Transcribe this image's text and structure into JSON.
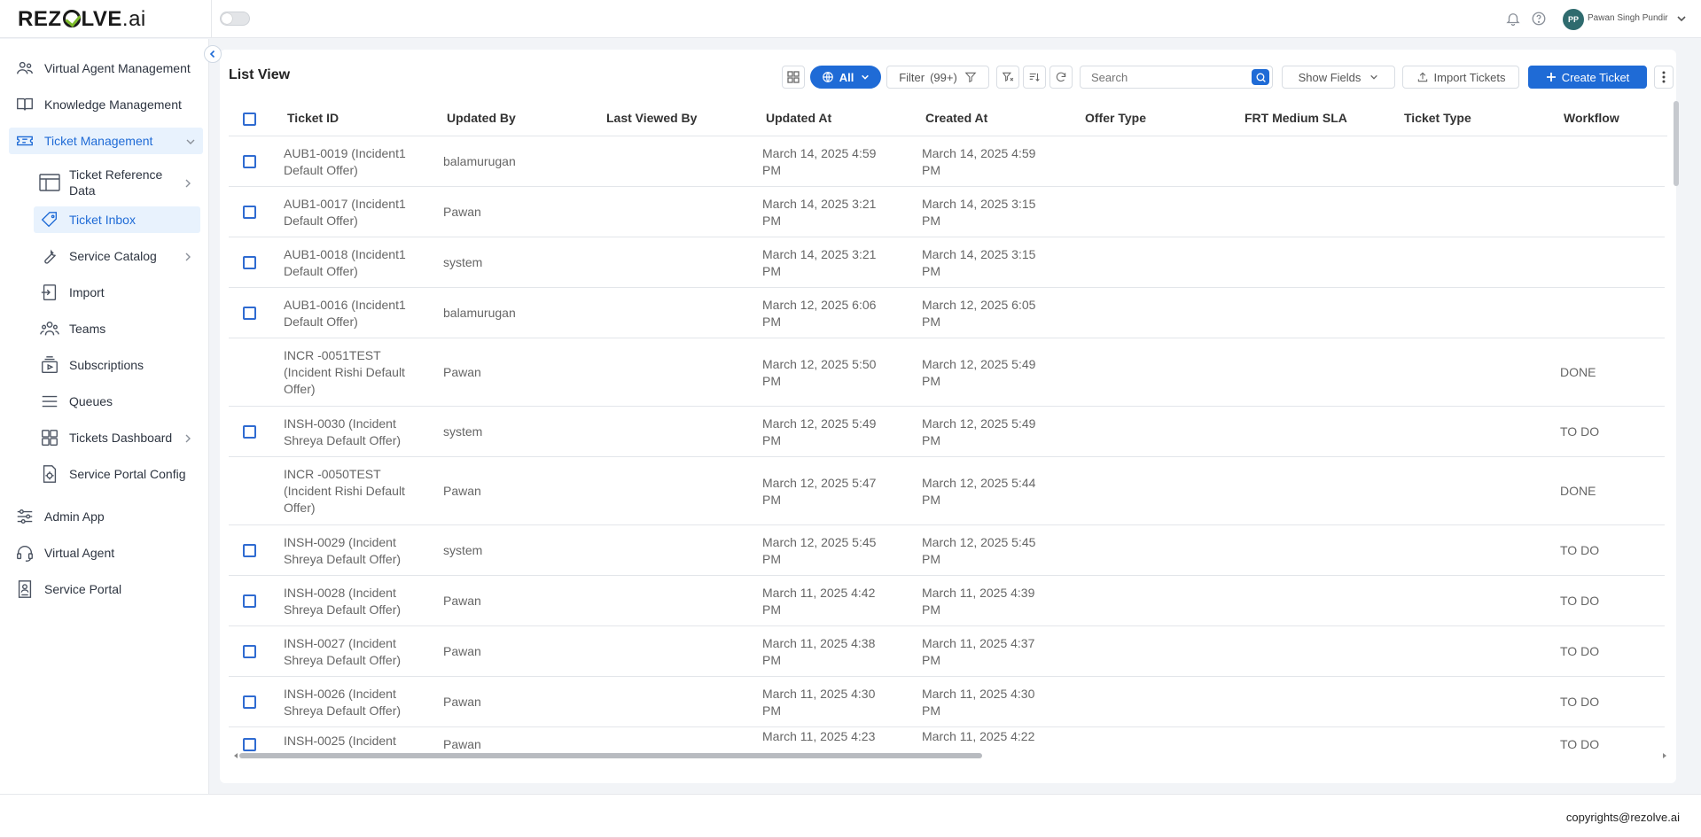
{
  "header": {
    "logo_main": "REZ",
    "logo_tail": "LVE",
    "logo_ai": ".ai",
    "user_initials": "PP",
    "user_name": "Pawan Singh Pundir"
  },
  "sidebar": {
    "items": [
      {
        "label": "Virtual Agent Management",
        "icon": "users-gear-icon"
      },
      {
        "label": "Knowledge Management",
        "icon": "book-icon"
      },
      {
        "label": "Ticket Management",
        "icon": "ticket-icon"
      },
      {
        "label": "Ticket Reference",
        "label2": "Data",
        "icon": "table-icon"
      },
      {
        "label": "Ticket Inbox",
        "icon": "tag-icon"
      },
      {
        "label": "Service Catalog",
        "icon": "wrench-icon"
      },
      {
        "label": "Import",
        "icon": "import-icon"
      },
      {
        "label": "Teams",
        "icon": "team-icon"
      },
      {
        "label": "Subscriptions",
        "icon": "subscription-icon"
      },
      {
        "label": "Queues",
        "icon": "queue-icon"
      },
      {
        "label": "Tickets Dashboard",
        "icon": "dashboard-icon"
      },
      {
        "label": "Service Portal Config",
        "icon": "config-icon"
      },
      {
        "label": "Admin App",
        "icon": "sliders-icon"
      },
      {
        "label": "Virtual Agent",
        "icon": "headset-icon"
      },
      {
        "label": "Service Portal",
        "icon": "portal-icon"
      }
    ]
  },
  "main": {
    "title": "List View",
    "toolbar": {
      "all_label": "All",
      "filter_label": "Filter",
      "filter_count": "(99+)",
      "search_placeholder": "Search",
      "show_fields_label": "Show Fields",
      "import_label": "Import Tickets",
      "create_label": "Create Ticket"
    },
    "columns": [
      "Ticket ID",
      "Updated By",
      "Last Viewed By",
      "Updated At",
      "Created At",
      "Offer Type",
      "FRT Medium SLA",
      "Ticket Type",
      "Workflow"
    ],
    "rows": [
      {
        "id": [
          "AUB1-0019 (Incident1",
          "Default Offer)"
        ],
        "updated_by": "balamurugan",
        "updated_at": [
          "March 14, 2025 4:59",
          "PM"
        ],
        "created_at": [
          "March 14, 2025 4:59",
          "PM"
        ],
        "workflow": "",
        "checkbox": true
      },
      {
        "id": [
          "AUB1-0017 (Incident1",
          "Default Offer)"
        ],
        "updated_by": "Pawan",
        "updated_at": [
          "March 14, 2025 3:21",
          "PM"
        ],
        "created_at": [
          "March 14, 2025 3:15",
          "PM"
        ],
        "workflow": "",
        "checkbox": true
      },
      {
        "id": [
          "AUB1-0018 (Incident1",
          "Default Offer)"
        ],
        "updated_by": "system",
        "updated_at": [
          "March 14, 2025 3:21",
          "PM"
        ],
        "created_at": [
          "March 14, 2025 3:15",
          "PM"
        ],
        "workflow": "",
        "checkbox": true
      },
      {
        "id": [
          "AUB1-0016 (Incident1",
          "Default Offer)"
        ],
        "updated_by": "balamurugan",
        "updated_at": [
          "March 12, 2025 6:06",
          "PM"
        ],
        "created_at": [
          "March 12, 2025 6:05",
          "PM"
        ],
        "workflow": "",
        "checkbox": true
      },
      {
        "id": [
          "INCR -0051TEST",
          "(Incident Rishi Default",
          "Offer)"
        ],
        "updated_by": "Pawan",
        "updated_at": [
          "March 12, 2025 5:50",
          "PM"
        ],
        "created_at": [
          "March 12, 2025 5:49",
          "PM"
        ],
        "workflow": "DONE",
        "checkbox": false
      },
      {
        "id": [
          "INSH-0030 (Incident",
          "Shreya Default Offer)"
        ],
        "updated_by": "system",
        "updated_at": [
          "March 12, 2025 5:49",
          "PM"
        ],
        "created_at": [
          "March 12, 2025 5:49",
          "PM"
        ],
        "workflow": "TO DO",
        "checkbox": true
      },
      {
        "id": [
          "INCR -0050TEST",
          "(Incident Rishi Default",
          "Offer)"
        ],
        "updated_by": "Pawan",
        "updated_at": [
          "March 12, 2025 5:47",
          "PM"
        ],
        "created_at": [
          "March 12, 2025 5:44",
          "PM"
        ],
        "workflow": "DONE",
        "checkbox": false
      },
      {
        "id": [
          "INSH-0029 (Incident",
          "Shreya Default Offer)"
        ],
        "updated_by": "system",
        "updated_at": [
          "March 12, 2025 5:45",
          "PM"
        ],
        "created_at": [
          "March 12, 2025 5:45",
          "PM"
        ],
        "workflow": "TO DO",
        "checkbox": true
      },
      {
        "id": [
          "INSH-0028 (Incident",
          "Shreya Default Offer)"
        ],
        "updated_by": "Pawan",
        "updated_at": [
          "March 11, 2025 4:42",
          "PM"
        ],
        "created_at": [
          "March 11, 2025 4:39",
          "PM"
        ],
        "workflow": "TO DO",
        "checkbox": true
      },
      {
        "id": [
          "INSH-0027 (Incident",
          "Shreya Default Offer)"
        ],
        "updated_by": "Pawan",
        "updated_at": [
          "March 11, 2025 4:38",
          "PM"
        ],
        "created_at": [
          "March 11, 2025 4:37",
          "PM"
        ],
        "workflow": "TO DO",
        "checkbox": true
      },
      {
        "id": [
          "INSH-0026 (Incident",
          "Shreya Default Offer)"
        ],
        "updated_by": "Pawan",
        "updated_at": [
          "March 11, 2025 4:30",
          "PM"
        ],
        "created_at": [
          "March 11, 2025 4:30",
          "PM"
        ],
        "workflow": "TO DO",
        "checkbox": true
      },
      {
        "id": [
          "INSH-0025 (Incident",
          ""
        ],
        "updated_by": "Pawan",
        "updated_at": [
          "March 11, 2025 4:23",
          ""
        ],
        "created_at": [
          "March 11, 2025 4:22",
          ""
        ],
        "workflow": "TO DO",
        "checkbox": true
      }
    ]
  },
  "footer": {
    "copyright": "copyrights@rezolve.ai"
  },
  "colors": {
    "accent": "#1f6bd6",
    "active_bg": "#e8f2fd"
  }
}
